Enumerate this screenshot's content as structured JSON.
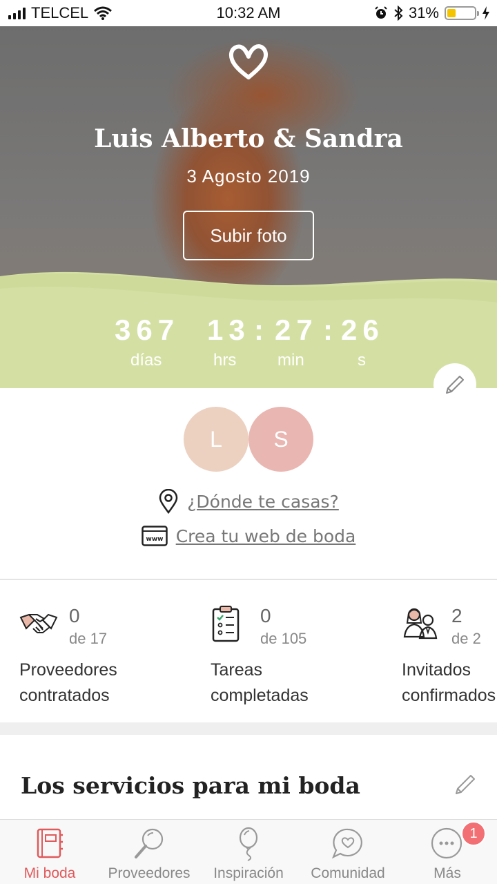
{
  "status_bar": {
    "carrier": "TELCEL",
    "time": "10:32 AM",
    "battery": "31%",
    "battery_level": 0.31,
    "icons": [
      "signal-icon",
      "wifi-icon",
      "alarm-icon",
      "bluetooth-icon",
      "battery-icon",
      "charging-icon"
    ]
  },
  "hero": {
    "couple_title": "Luis Alberto & Sandra",
    "wedding_date": "3 Agosto 2019",
    "upload_label": "Subir foto",
    "countdown": [
      {
        "value": "367",
        "unit": "días"
      },
      {
        "value": "13",
        "unit": "hrs"
      },
      {
        "value": "27",
        "unit": "min"
      },
      {
        "value": "26",
        "unit": "s"
      }
    ],
    "separator": ":",
    "colors": {
      "green": "#d4e0a3",
      "white": "#ffffff"
    }
  },
  "couple": {
    "initial_1": "L",
    "initial_2": "S",
    "colors": {
      "l": "#ecd1c1",
      "s": "#e8b3ad"
    },
    "where_link": "¿Dónde te casas?",
    "web_link": "Crea tu web de boda"
  },
  "stats": [
    {
      "icon": "handshake-icon",
      "count": "0",
      "total": "de 17",
      "label_1": "Proveedores",
      "label_2": "contratados"
    },
    {
      "icon": "checklist-icon",
      "count": "0",
      "total": "de 105",
      "label_1": "Tareas",
      "label_2": "completadas"
    },
    {
      "icon": "guests-icon",
      "count": "2",
      "total": "de 2",
      "label_1": "Invitados",
      "label_2": "confirmados"
    }
  ],
  "services": {
    "title": "Los servicios para mi boda"
  },
  "tabbar": {
    "tabs": [
      {
        "label": "Mi boda",
        "icon": "notebook-icon",
        "active": true
      },
      {
        "label": "Proveedores",
        "icon": "magnifier-icon",
        "active": false
      },
      {
        "label": "Inspiración",
        "icon": "balloon-icon",
        "active": false
      },
      {
        "label": "Comunidad",
        "icon": "chat-heart-icon",
        "active": false
      },
      {
        "label": "Más",
        "icon": "more-icon",
        "active": false
      }
    ],
    "more_badge": "1",
    "accent": "#e0595b"
  }
}
